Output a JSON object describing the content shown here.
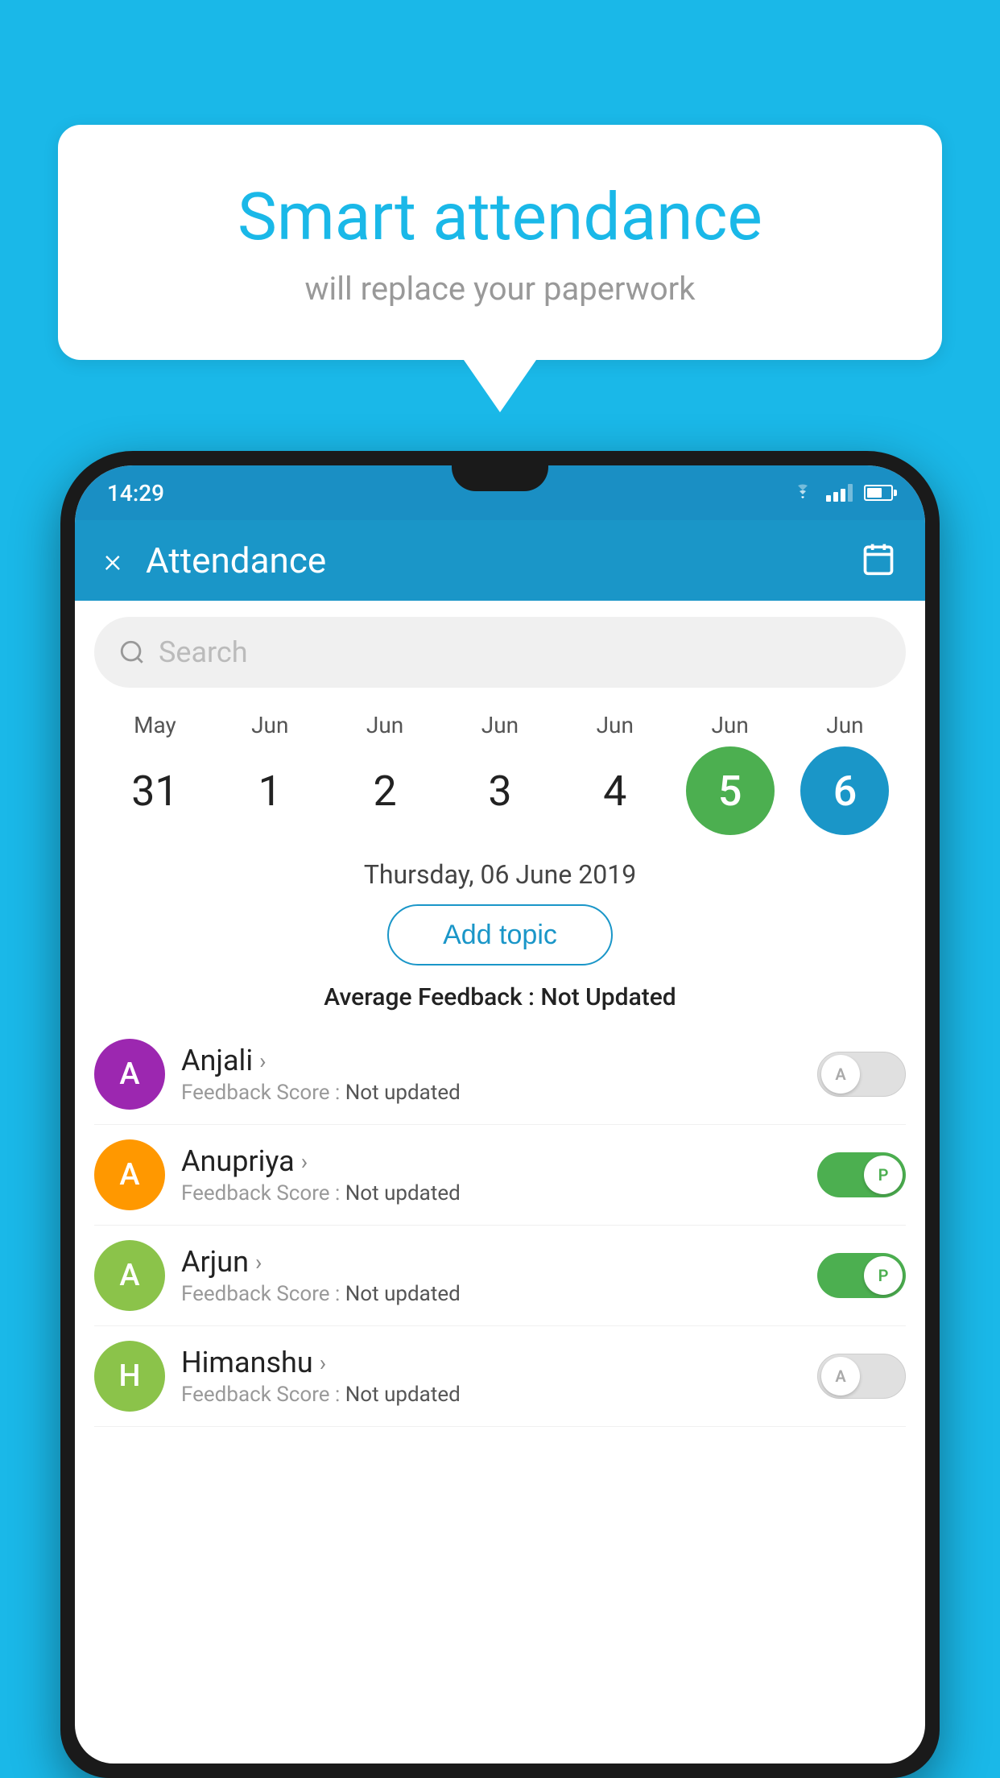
{
  "background_color": "#1ab8e8",
  "speech_bubble": {
    "title": "Smart attendance",
    "subtitle": "will replace your paperwork"
  },
  "status_bar": {
    "time": "14:29"
  },
  "header": {
    "title": "Attendance",
    "close_label": "×"
  },
  "search": {
    "placeholder": "Search"
  },
  "calendar": {
    "months": [
      "May",
      "Jun",
      "Jun",
      "Jun",
      "Jun",
      "Jun",
      "Jun"
    ],
    "dates": [
      "31",
      "1",
      "2",
      "3",
      "4",
      "5",
      "6"
    ],
    "today_index": 5,
    "selected_index": 6
  },
  "selected_date": "Thursday, 06 June 2019",
  "add_topic_label": "Add topic",
  "avg_feedback_label": "Average Feedback :",
  "avg_feedback_value": "Not Updated",
  "students": [
    {
      "name": "Anjali",
      "avatar_letter": "A",
      "avatar_color": "#9c27b0",
      "feedback_label": "Feedback Score :",
      "feedback_value": "Not updated",
      "toggle_state": "off",
      "toggle_label": "A"
    },
    {
      "name": "Anupriya",
      "avatar_letter": "A",
      "avatar_color": "#ff9800",
      "feedback_label": "Feedback Score :",
      "feedback_value": "Not updated",
      "toggle_state": "on",
      "toggle_label": "P"
    },
    {
      "name": "Arjun",
      "avatar_letter": "A",
      "avatar_color": "#8bc34a",
      "feedback_label": "Feedback Score :",
      "feedback_value": "Not updated",
      "toggle_state": "on",
      "toggle_label": "P"
    },
    {
      "name": "Himanshu",
      "avatar_letter": "H",
      "avatar_color": "#8bc34a",
      "feedback_label": "Feedback Score :",
      "feedback_value": "Not updated",
      "toggle_state": "off",
      "toggle_label": "A"
    }
  ]
}
